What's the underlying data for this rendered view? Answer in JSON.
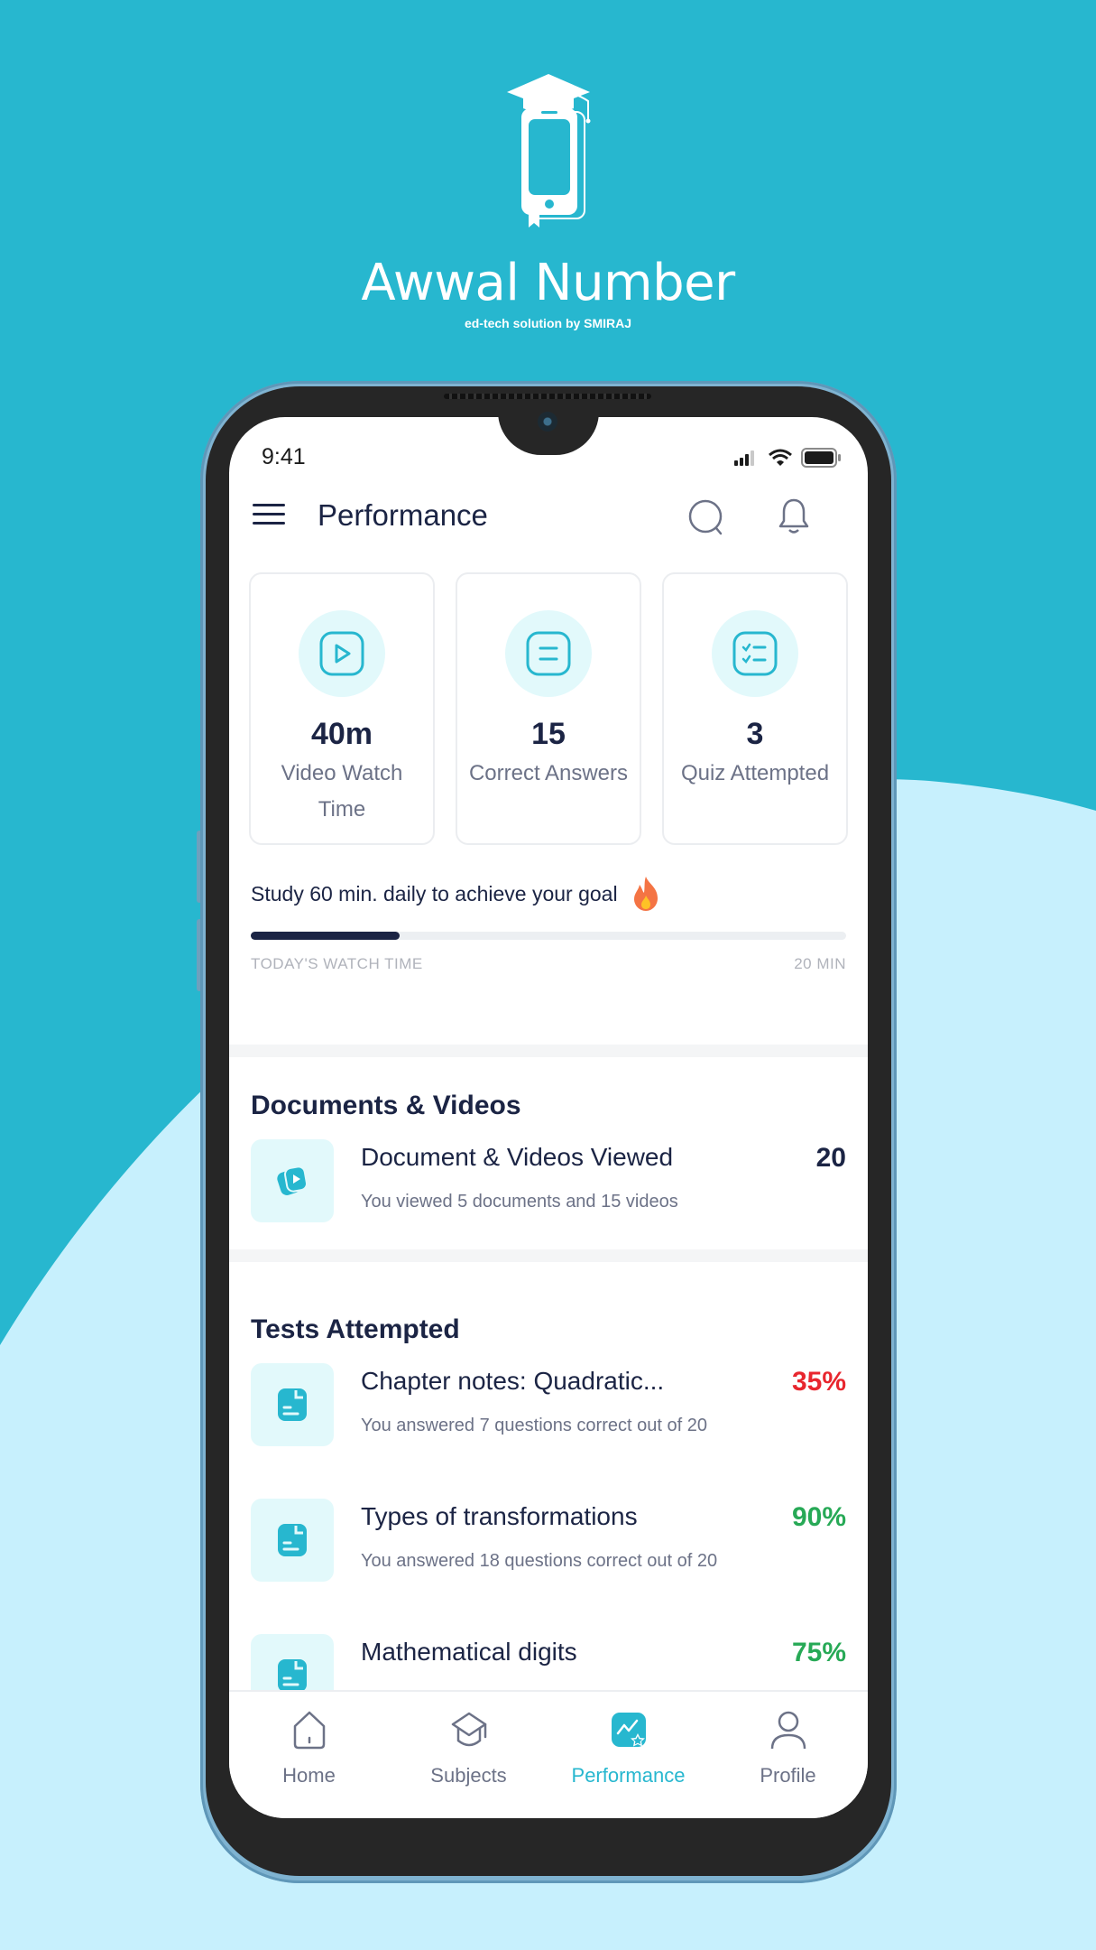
{
  "brand": {
    "title": "Awwal Number",
    "subtitle": "ed-tech solution by SMIRAJ"
  },
  "status_bar": {
    "time": "9:41"
  },
  "app_bar": {
    "title": "Performance",
    "icons": [
      "menu-icon",
      "search-icon",
      "bell-icon"
    ]
  },
  "stats": [
    {
      "icon": "play-icon",
      "value": "40m",
      "label": "Video Watch Time"
    },
    {
      "icon": "list-icon",
      "value": "15",
      "label": "Correct Answers"
    },
    {
      "icon": "checklist-icon",
      "value": "3",
      "label": "Quiz Attempted"
    }
  ],
  "goal": {
    "text": "Study 60 min. daily to achieve your goal",
    "icon": "fire-icon",
    "progress_percent": 25,
    "left_label": "TODAY'S WATCH TIME",
    "right_label": "20 MIN"
  },
  "documents_section": {
    "title": "Documents & Videos",
    "item": {
      "title": "Document & Videos Viewed",
      "subtitle": "You viewed 5 documents and 15 videos",
      "value": "20"
    }
  },
  "tests_section": {
    "title": "Tests Attempted",
    "items": [
      {
        "title": "Chapter notes: Quadratic...",
        "subtitle": "You answered 7 questions correct out of 20",
        "score": "35%",
        "color": "#e8262e"
      },
      {
        "title": "Types of transformations",
        "subtitle": "You answered 18 questions correct out of 20",
        "score": "90%",
        "color": "#27a956"
      },
      {
        "title": "Mathematical digits",
        "subtitle": "",
        "score": "75%",
        "color": "#27a956"
      }
    ]
  },
  "bottom_nav": {
    "items": [
      {
        "label": "Home",
        "icon": "home-icon",
        "active": false
      },
      {
        "label": "Subjects",
        "icon": "graduation-cap-icon",
        "active": false
      },
      {
        "label": "Performance",
        "icon": "performance-chart-icon",
        "active": true
      },
      {
        "label": "Profile",
        "icon": "profile-icon",
        "active": false
      }
    ]
  },
  "colors": {
    "accent": "#27b7cf",
    "background_dark": "#27b7cf",
    "background_light": "#c7f0fd",
    "text_primary": "#1b2444",
    "text_secondary": "#6c7287",
    "score_low": "#e8262e",
    "score_high": "#27a956"
  }
}
